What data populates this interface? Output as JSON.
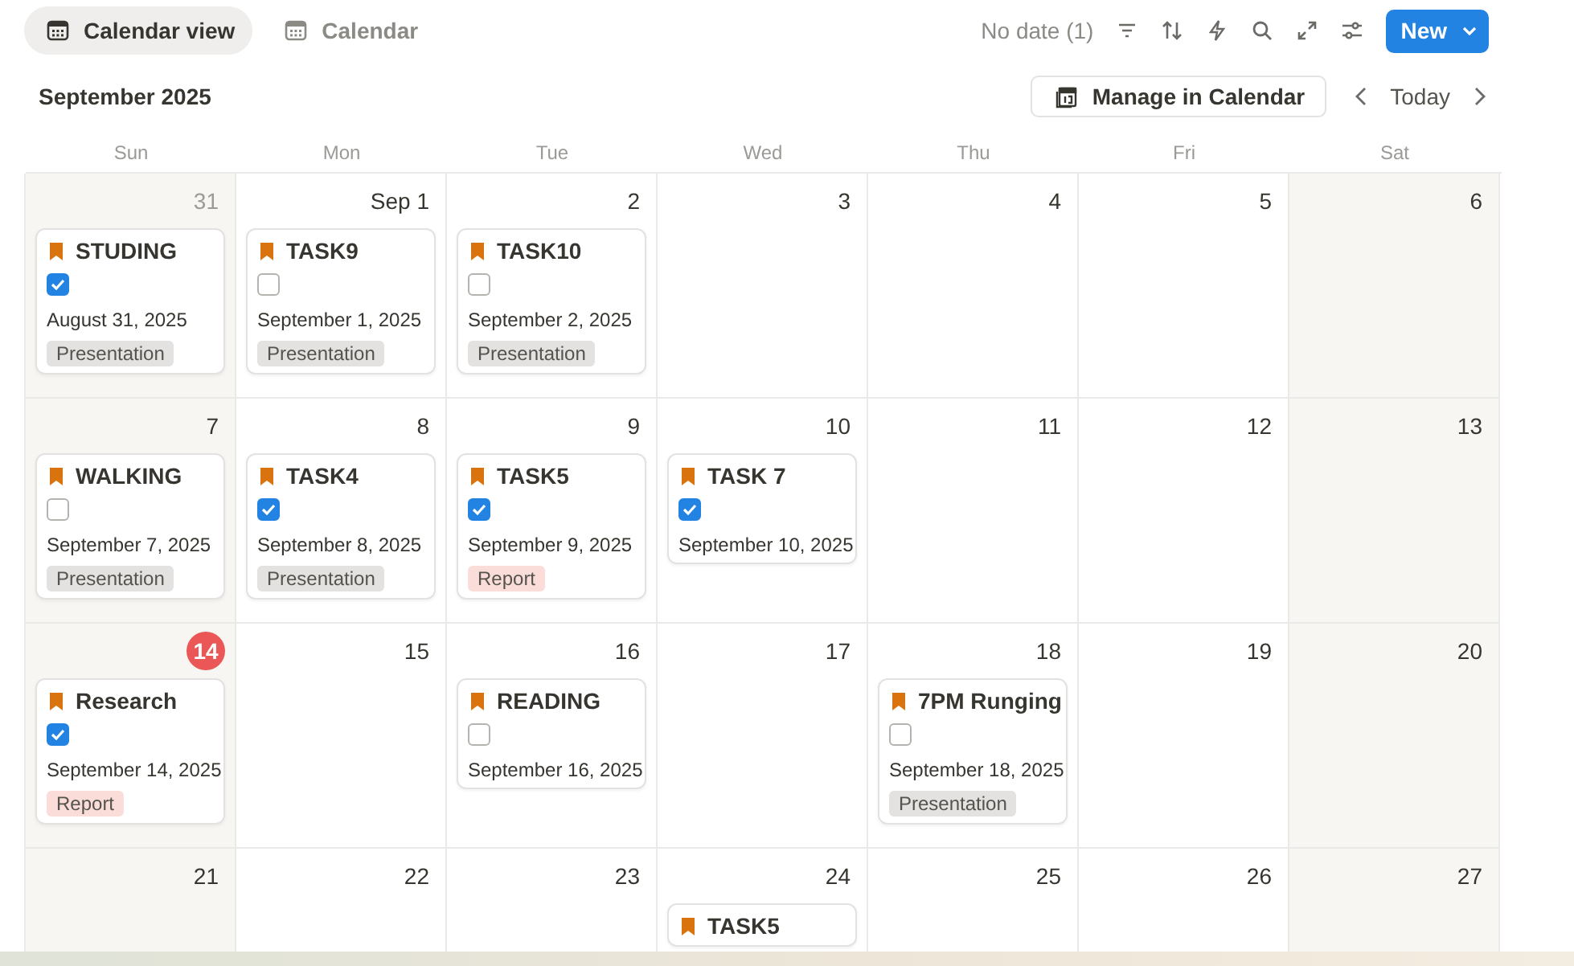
{
  "tabs": [
    {
      "label": "Calendar view",
      "selected": true
    },
    {
      "label": "Calendar",
      "selected": false
    }
  ],
  "toolbar": {
    "no_date": "No date (1)",
    "new_button": "New"
  },
  "header": {
    "month": "September 2025",
    "manage_button": "Manage in Calendar",
    "today_button": "Today"
  },
  "weekdays": [
    "Sun",
    "Mon",
    "Tue",
    "Wed",
    "Thu",
    "Fri",
    "Sat"
  ],
  "weeks": [
    {
      "days": [
        {
          "label": "31",
          "outside": true,
          "events": [
            {
              "title": "STUDING",
              "checked": true,
              "date": "August 31, 2025",
              "tag": {
                "text": "Presentation",
                "color": "#e3e2e0"
              }
            }
          ]
        },
        {
          "label": "Sep 1",
          "events": [
            {
              "title": "TASK9",
              "checked": false,
              "date": "September 1, 2025",
              "tag": {
                "text": "Presentation",
                "color": "#e3e2e0"
              }
            }
          ]
        },
        {
          "label": "2",
          "events": [
            {
              "title": "TASK10",
              "checked": false,
              "date": "September 2, 2025",
              "tag": {
                "text": "Presentation",
                "color": "#e3e2e0"
              }
            }
          ]
        },
        {
          "label": "3"
        },
        {
          "label": "4"
        },
        {
          "label": "5"
        },
        {
          "label": "6"
        }
      ]
    },
    {
      "days": [
        {
          "label": "7",
          "events": [
            {
              "title": "WALKING",
              "checked": false,
              "date": "September 7, 2025",
              "tag": {
                "text": "Presentation",
                "color": "#e3e2e0"
              }
            }
          ]
        },
        {
          "label": "8",
          "events": [
            {
              "title": "TASK4",
              "checked": true,
              "date": "September 8, 2025",
              "tag": {
                "text": "Presentation",
                "color": "#e3e2e0"
              }
            }
          ]
        },
        {
          "label": "9",
          "events": [
            {
              "title": "TASK5",
              "checked": true,
              "date": "September 9, 2025",
              "tag": {
                "text": "Report",
                "color": "#fadcd9"
              }
            }
          ]
        },
        {
          "label": "10",
          "events": [
            {
              "title": "TASK 7",
              "checked": true,
              "date": "September 10, 2025"
            }
          ]
        },
        {
          "label": "11"
        },
        {
          "label": "12"
        },
        {
          "label": "13"
        }
      ]
    },
    {
      "days": [
        {
          "label": "14",
          "today": true,
          "events": [
            {
              "title": "Research",
              "checked": true,
              "date": "September 14, 2025",
              "tag": {
                "text": "Report",
                "color": "#fadcd9"
              }
            }
          ]
        },
        {
          "label": "15"
        },
        {
          "label": "16",
          "events": [
            {
              "title": "READING",
              "checked": false,
              "date": "September 16, 2025"
            }
          ]
        },
        {
          "label": "17"
        },
        {
          "label": "18",
          "events": [
            {
              "title": "7PM Runging",
              "checked": false,
              "date": "September 18, 2025",
              "tag": {
                "text": "Presentation",
                "color": "#e3e2e0"
              }
            }
          ]
        },
        {
          "label": "19"
        },
        {
          "label": "20"
        }
      ]
    },
    {
      "days": [
        {
          "label": "21"
        },
        {
          "label": "22"
        },
        {
          "label": "23"
        },
        {
          "label": "24",
          "events": [
            {
              "title": "TASK5"
            }
          ]
        },
        {
          "label": "25"
        },
        {
          "label": "26"
        },
        {
          "label": "27"
        }
      ]
    }
  ]
}
